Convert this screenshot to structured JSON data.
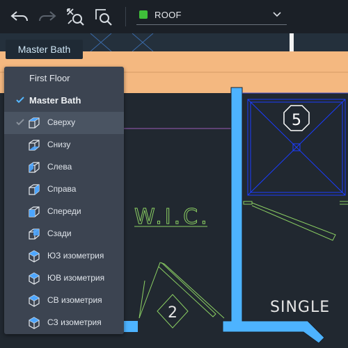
{
  "toolbar": {
    "undo_icon": "undo-arrow-icon",
    "redo_icon": "redo-arrow-icon",
    "zoom_extents_icon": "zoom-extents-icon",
    "zoom_window_icon": "zoom-window-icon",
    "layer": {
      "name": "ROOF",
      "swatch_color": "#3fbf3a"
    }
  },
  "tooltip": {
    "text": "Master Bath"
  },
  "view_menu": {
    "items": [
      {
        "label": "First Floor",
        "kind": "named-view",
        "checked": false
      },
      {
        "label": "Master Bath",
        "kind": "named-view",
        "checked": true
      },
      {
        "label": "Сверху",
        "icon": "view-top-icon",
        "checked": true,
        "highlighted": true
      },
      {
        "label": "Снизу",
        "icon": "view-bottom-icon"
      },
      {
        "label": "Слева",
        "icon": "view-left-icon"
      },
      {
        "label": "Справа",
        "icon": "view-right-icon"
      },
      {
        "label": "Спереди",
        "icon": "view-front-icon"
      },
      {
        "label": "Сзади",
        "icon": "view-back-icon"
      },
      {
        "label": "ЮЗ изометрия",
        "icon": "sw-iso-icon"
      },
      {
        "label": "ЮВ изометрия",
        "icon": "se-iso-icon"
      },
      {
        "label": "СВ изометрия",
        "icon": "ne-iso-icon"
      },
      {
        "label": "СЗ изометрия",
        "icon": "nw-iso-icon"
      }
    ]
  },
  "drawing": {
    "room_label": "W.I.C.",
    "room_label_2": "SINGLE",
    "tag_1": "5",
    "tag_2": "2",
    "colors": {
      "wall": "#4db3ff",
      "band": "#f4b880",
      "annotation": "#8bcf63",
      "fixture": "#1a3cff",
      "text": "#e6e6e6"
    }
  }
}
